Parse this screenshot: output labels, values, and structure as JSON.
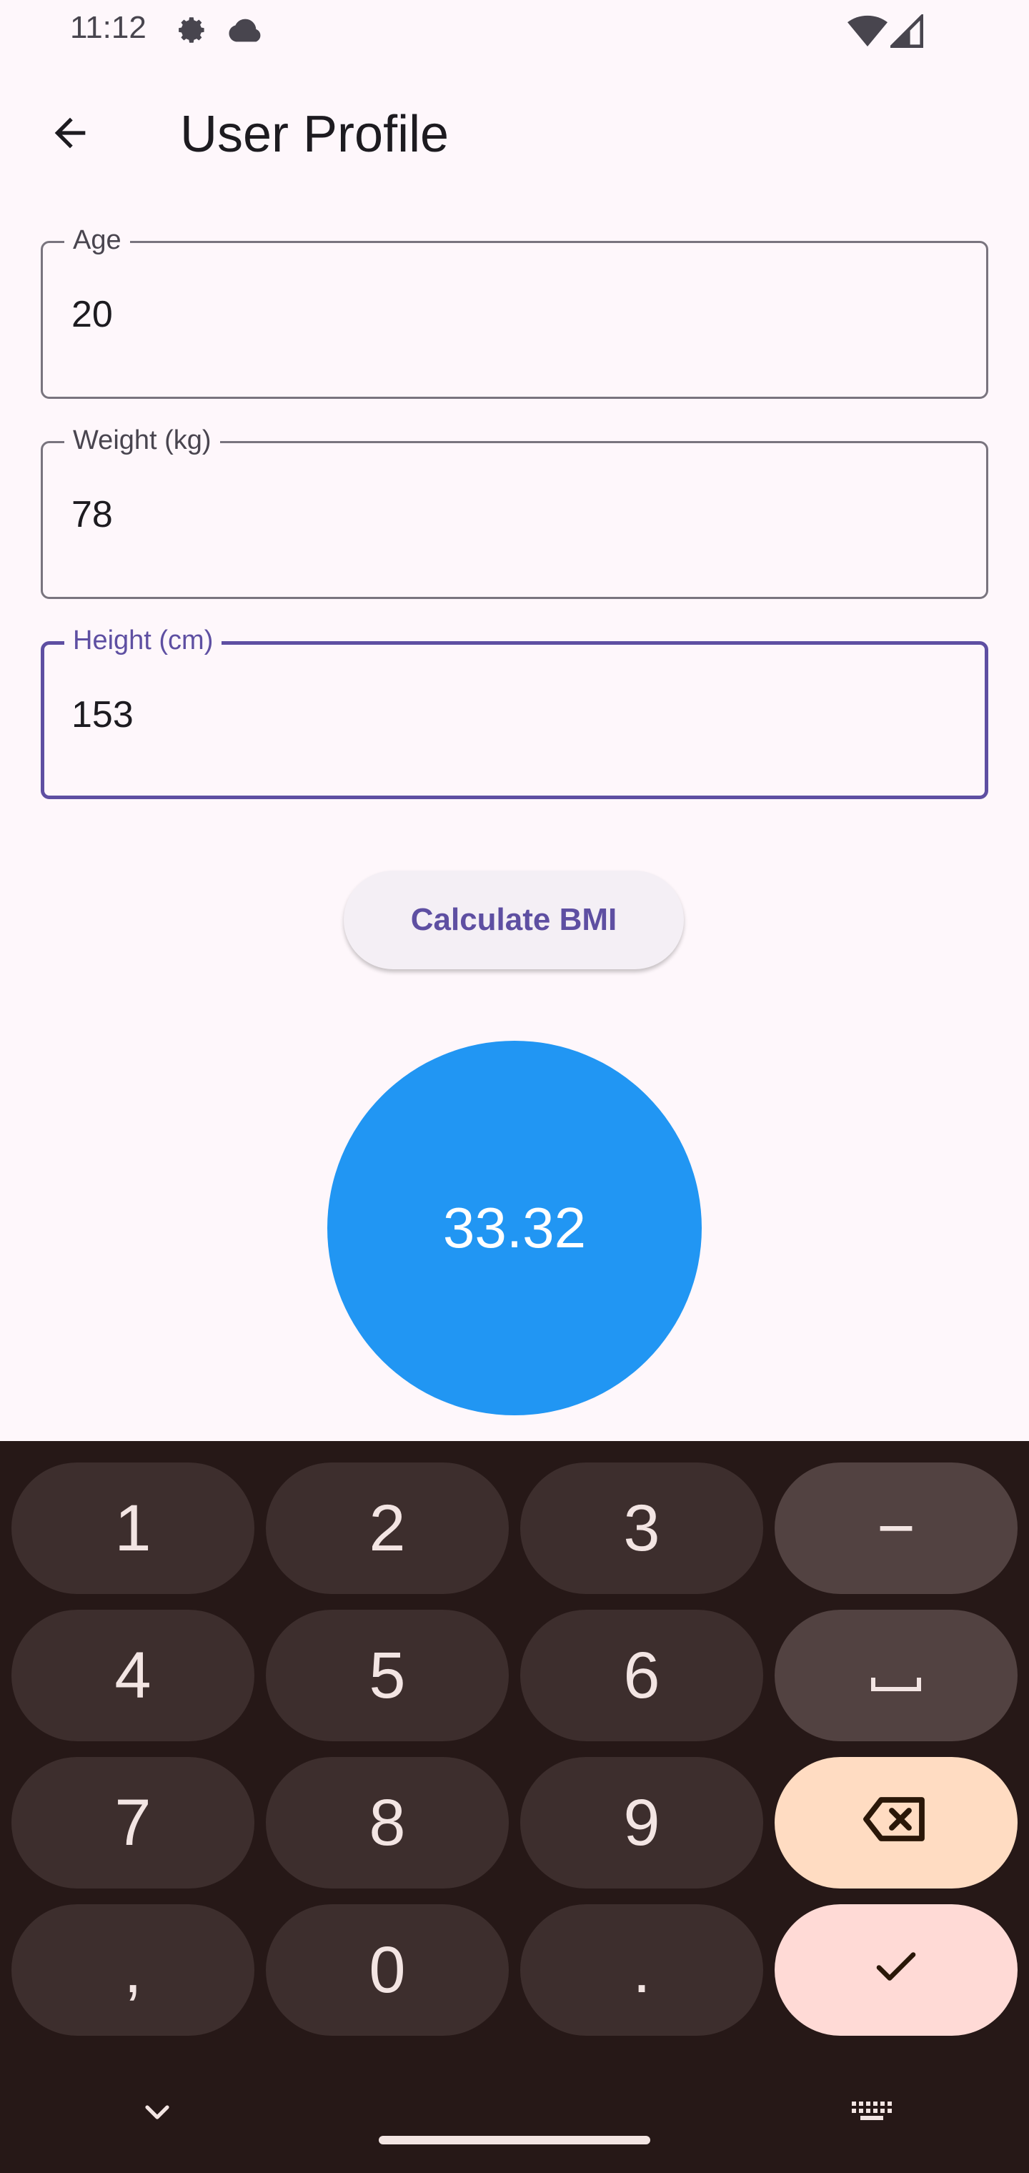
{
  "status_bar": {
    "time": "11:12",
    "icons": [
      "settings-gear-icon",
      "cloud-icon",
      "wifi-icon",
      "cell-signal-icon"
    ]
  },
  "app_bar": {
    "back_icon": "arrow-back-icon",
    "title": "User Profile"
  },
  "form": {
    "age": {
      "label": "Age",
      "value": "20"
    },
    "weight": {
      "label": "Weight (kg)",
      "value": "78"
    },
    "height": {
      "label": "Height (cm)",
      "value": "153",
      "focused": true
    }
  },
  "calculate_button": {
    "label": "Calculate BMI"
  },
  "result": {
    "bmi": "33.32",
    "color": "#2196f3"
  },
  "keyboard": {
    "keys": [
      [
        "1",
        "2",
        "3",
        "−"
      ],
      [
        "4",
        "5",
        "6",
        "space-icon"
      ],
      [
        "7",
        "8",
        "9",
        "backspace-icon"
      ],
      [
        ",",
        "0",
        ".",
        "check-icon"
      ]
    ],
    "nav_icons": [
      "chevron-down-icon",
      "keyboard-icon"
    ]
  },
  "colors": {
    "accent": "#5e4fa2",
    "background": "#fef7fb",
    "keyboard_bg": "#261817",
    "key_bg": "#3d2e2d",
    "backspace_key": "#ffdcc2",
    "enter_key": "#ffdad6"
  }
}
